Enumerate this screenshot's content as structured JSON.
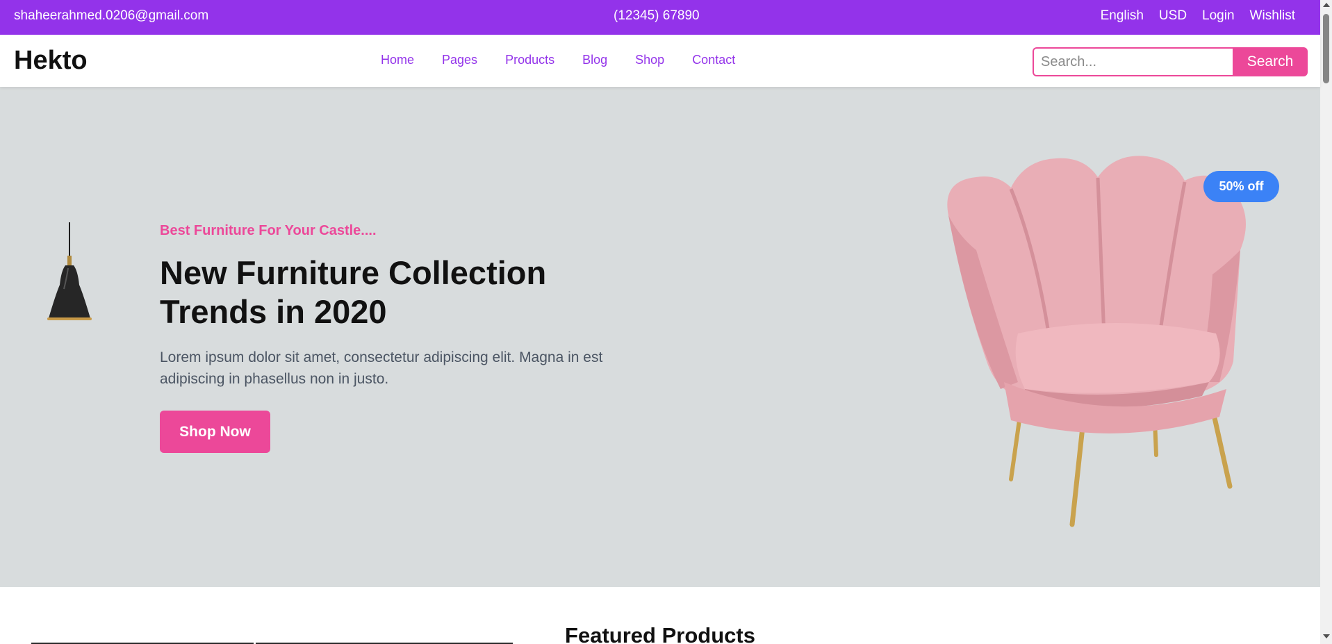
{
  "topbar": {
    "email": "shaheerahmed.0206@gmail.com",
    "phone": "(12345) 67890",
    "language": "English",
    "currency": "USD",
    "login": "Login",
    "wishlist": "Wishlist",
    "background": "#9333ea"
  },
  "navbar": {
    "brand": "Hekto",
    "links": [
      "Home",
      "Pages",
      "Products",
      "Blog",
      "Shop",
      "Contact"
    ],
    "search": {
      "placeholder": "Search...",
      "value": "",
      "button_label": "Search"
    }
  },
  "hero": {
    "tagline": "Best Furniture For Your Castle....",
    "headline": "New Furniture Collection Trends in 2020",
    "description": "Lorem ipsum dolor sit amet, consectetur adipiscing elit. Magna in est adipiscing in phasellus non in justo.",
    "cta_label": "Shop Now",
    "badge": "50% off",
    "background": "#d8dcdd"
  },
  "featured": {
    "title": "Featured Products"
  },
  "colors": {
    "accent_pink": "#ec4899",
    "accent_purple": "#9333ea",
    "badge_blue": "#3b82f6"
  }
}
